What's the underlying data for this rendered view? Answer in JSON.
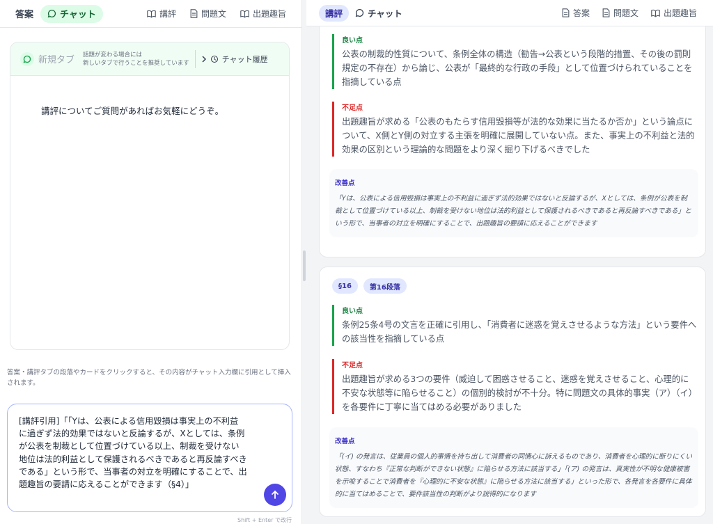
{
  "left": {
    "tabs": {
      "answer": "答案",
      "chat": "チャット",
      "review": "講評",
      "problem": "問題文",
      "purpose": "出題趣旨"
    },
    "chat": {
      "new_tab": "新規タブ",
      "hint_line1": "話題が変わる場合には",
      "hint_line2": "新しいタブで行うことを推奨しています",
      "history": "チャット履歴",
      "welcome": "講評についてご質問があればお気軽にどうぞ。"
    },
    "insert_note": "答案・講評タブの段落やカードをクリックすると、その内容がチャット入力欄に引用として挿入されます。",
    "input_value": "[講評引用]「「Yは、公表による信用毀損は事実上の不利益\nに過ぎず法的効果ではないと反論するが、Xとしては、条例\nが公表を制裁として位置づけている以上、制裁を受けない\n地位は法的利益として保護されるべきであると再反論すべき\nである」という形で、当事者の対立を明確にすることで、出\n題趣旨の要請に応えることができます（§4）」",
    "shortcut": "Shift + Enter で改行"
  },
  "right": {
    "tabs": {
      "review": "講評",
      "chat": "チャット",
      "answer": "答案",
      "problem": "問題文",
      "purpose": "出題趣旨"
    },
    "card1": {
      "good_label": "良い点",
      "good_text": "公表の制裁的性質について、条例全体の構造（勧告→公表という段階的措置、その後の罰則規定の不存在）から論じ、公表が「最終的な行政の手段」として位置づけられていることを指摘している点",
      "bad_label": "不足点",
      "bad_text": "出題趣旨が求める「公表のもたらす信用毀損等が法的な効果に当たるか否か」という論点について、X側とY側の対立する主張を明確に展開していない点。また、事実上の不利益と法的効果の区別という理論的な問題をより深く掘り下げるべきでした",
      "improve_label": "改善点",
      "improve_text": "「Yは、公表による信用毀損は事実上の不利益に過ぎず法的効果ではないと反論するが、Xとしては、条例が公表を制裁として位置づけている以上、制裁を受けない地位は法的利益として保護されるべきであると再反論すべきである」という形で、当事者の対立を明確にすることで、出題趣旨の要請に応えることができます"
    },
    "card2": {
      "section": "§16",
      "paragraph": "第16段落",
      "good_label": "良い点",
      "good_text": "条例25条4号の文言を正確に引用し、「消費者に迷惑を覚えさせるような方法」という要件への該当性を指摘している点",
      "bad_label": "不足点",
      "bad_text": "出題趣旨が求める3つの要件（威迫して困惑させること、迷惑を覚えさせること、心理的に不安な状態等に陥らせること）の個別的検討が不十分。特に問題文の具体的事実（ア）（イ）を各要件に丁寧に当てはめる必要がありました",
      "improve_label": "改善点",
      "improve_text": "「(イ) の発言は、従業員の個人的事情を持ち出して消費者の同情心に訴えるものであり、消費者を心理的に断りにくい状態、すなわち『正常な判断ができない状態』に陥らせる方法に該当する」「(ア) の発言は、真実性が不明な健康被害を示唆することで消費者を『心理的に不安な状態』に陥らせる方法に該当する」といった形で、各発言を各要件に具体的に当てはめることで、要件該当性の判断がより説得的になります"
    }
  },
  "colors": {
    "chat_green": "#dcfce7",
    "accent_indigo": "#4f46e5",
    "good": "#16a34a",
    "bad": "#dc2626"
  },
  "icons": [
    "chat-bubble-icon",
    "book-icon",
    "document-icon",
    "chevron-right-icon",
    "history-icon",
    "send-arrow-icon"
  ]
}
